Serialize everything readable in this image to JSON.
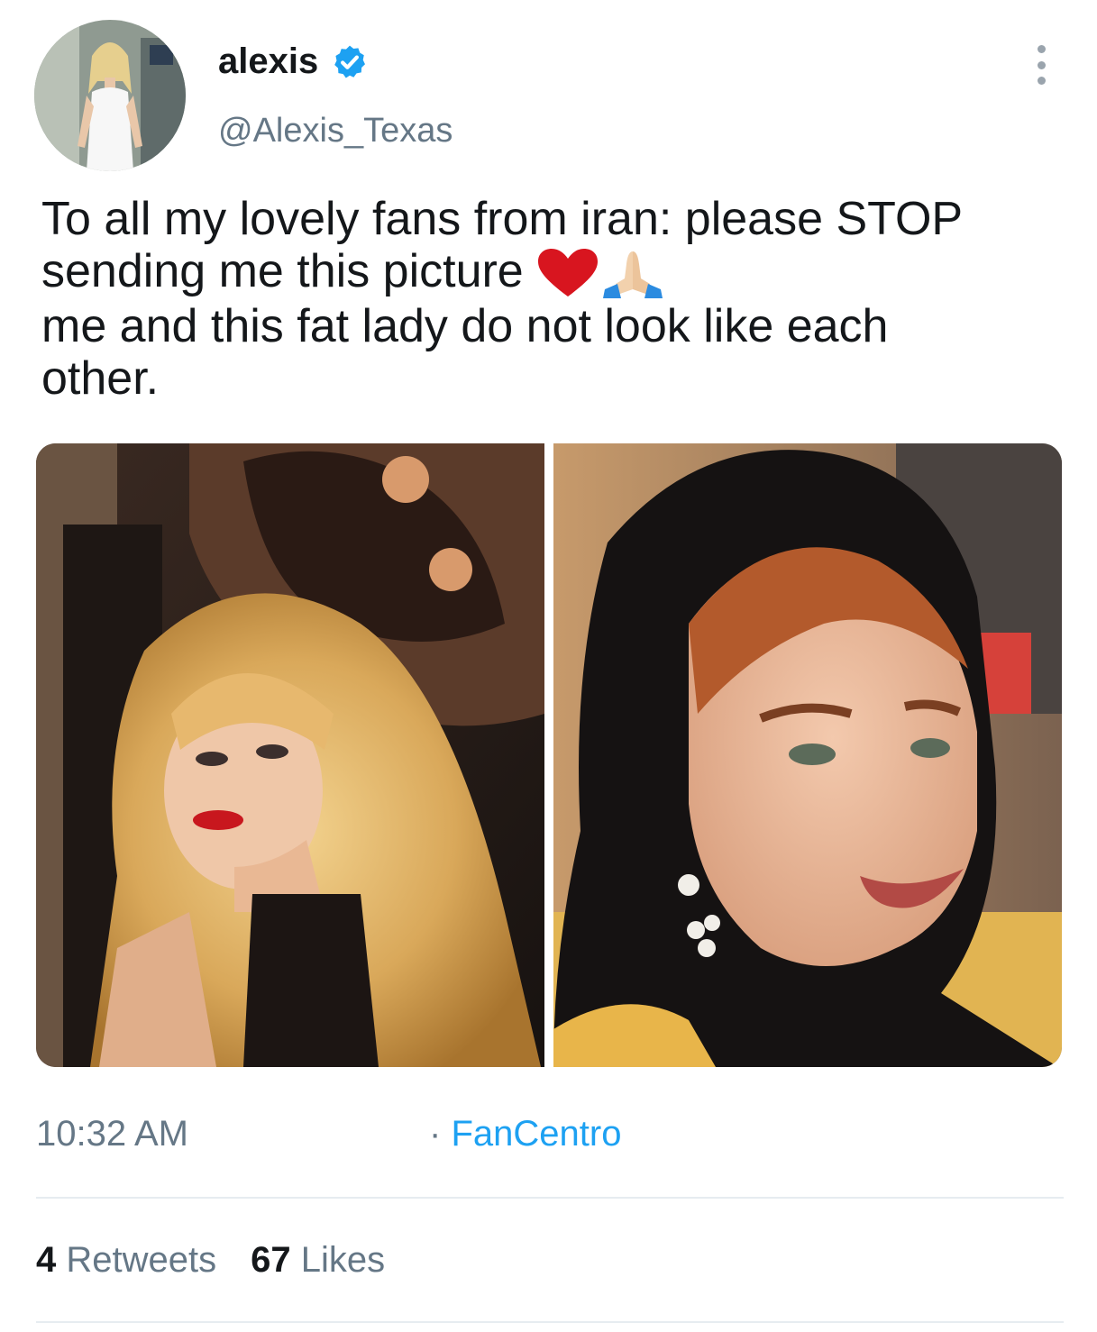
{
  "user": {
    "name": "alexis",
    "handle": "@Alexis_Texas",
    "verified": true,
    "verified_color": "#1da1f2"
  },
  "tweet": {
    "lines": [
      "To all my lovely fans from iran: please STOP",
      "sending me this picture",
      "me and this fat lady do not look like each",
      "other."
    ],
    "emojis": [
      "heart",
      "folded-hands"
    ],
    "time": "10:32 AM",
    "source_separator": "·",
    "source": "FanCentro",
    "retweets_count": "4",
    "retweets_label": "Retweets",
    "likes_count": "67",
    "likes_label": "Likes"
  },
  "colors": {
    "text": "#14171a",
    "muted": "#657786",
    "link": "#1da1f2",
    "divider": "#e6ecf0"
  }
}
